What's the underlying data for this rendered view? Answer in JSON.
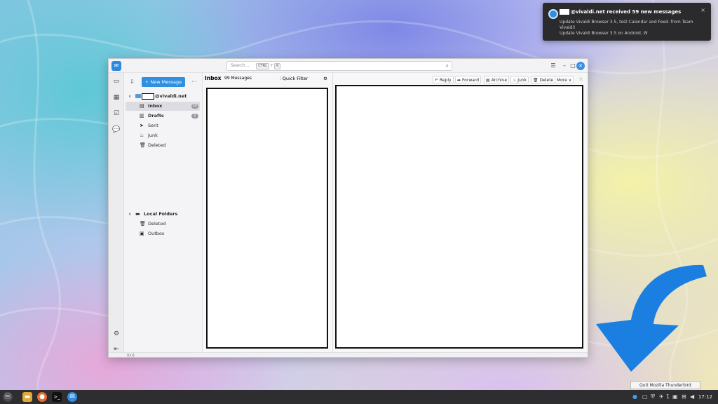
{
  "notification": {
    "title": "@vivaldi.net received 59 new messages",
    "line1": "Update Vivaldi Browser 3.5, test Calendar and Feed. from Team Vivaldi!",
    "line2": "Update Vivaldi Browser 3.5 on Android, W",
    "close": "×"
  },
  "window": {
    "search_placeholder": "Search...",
    "search_kbd1": "CTRL",
    "search_plus": "+",
    "search_kbd2": "K"
  },
  "folder_pane": {
    "new_message_label": "New Message",
    "more": "···",
    "account_label": "@vivaldi.net",
    "folders": [
      {
        "label": "Inbox",
        "badge": "59",
        "icon": "inbox-icon",
        "glyph": "▤"
      },
      {
        "label": "Drafts",
        "badge": "1",
        "icon": "drafts-icon",
        "glyph": "▥"
      },
      {
        "label": "Sent",
        "badge": "",
        "icon": "sent-icon",
        "glyph": "➤"
      },
      {
        "label": "Junk",
        "badge": "",
        "icon": "junk-icon",
        "glyph": "♨"
      },
      {
        "label": "Deleted",
        "badge": "",
        "icon": "trash-icon",
        "glyph": "🗑"
      }
    ],
    "local_folders_label": "Local Folders",
    "local_folders": [
      {
        "label": "Deleted",
        "icon": "trash-icon",
        "glyph": "🗑"
      },
      {
        "label": "Outbox",
        "icon": "outbox-icon",
        "glyph": "▣"
      }
    ]
  },
  "message_list": {
    "folder_title": "Inbox",
    "count": "99 Messages",
    "quick_filter": "Quick Filter"
  },
  "reader_toolbar": {
    "reply": "Reply",
    "forward": "Forward",
    "archive": "Archive",
    "junk": "Junk",
    "delete": "Delete",
    "more": "More"
  },
  "statusbar": {
    "text": "((•))"
  },
  "tooltip": {
    "text": "Quit Mozilla Thunderbird"
  },
  "taskbar": {
    "time": "17:12",
    "tray_count": "1"
  },
  "colors": {
    "accent": "#2f8fe0",
    "arrow": "#1a7fe0"
  }
}
